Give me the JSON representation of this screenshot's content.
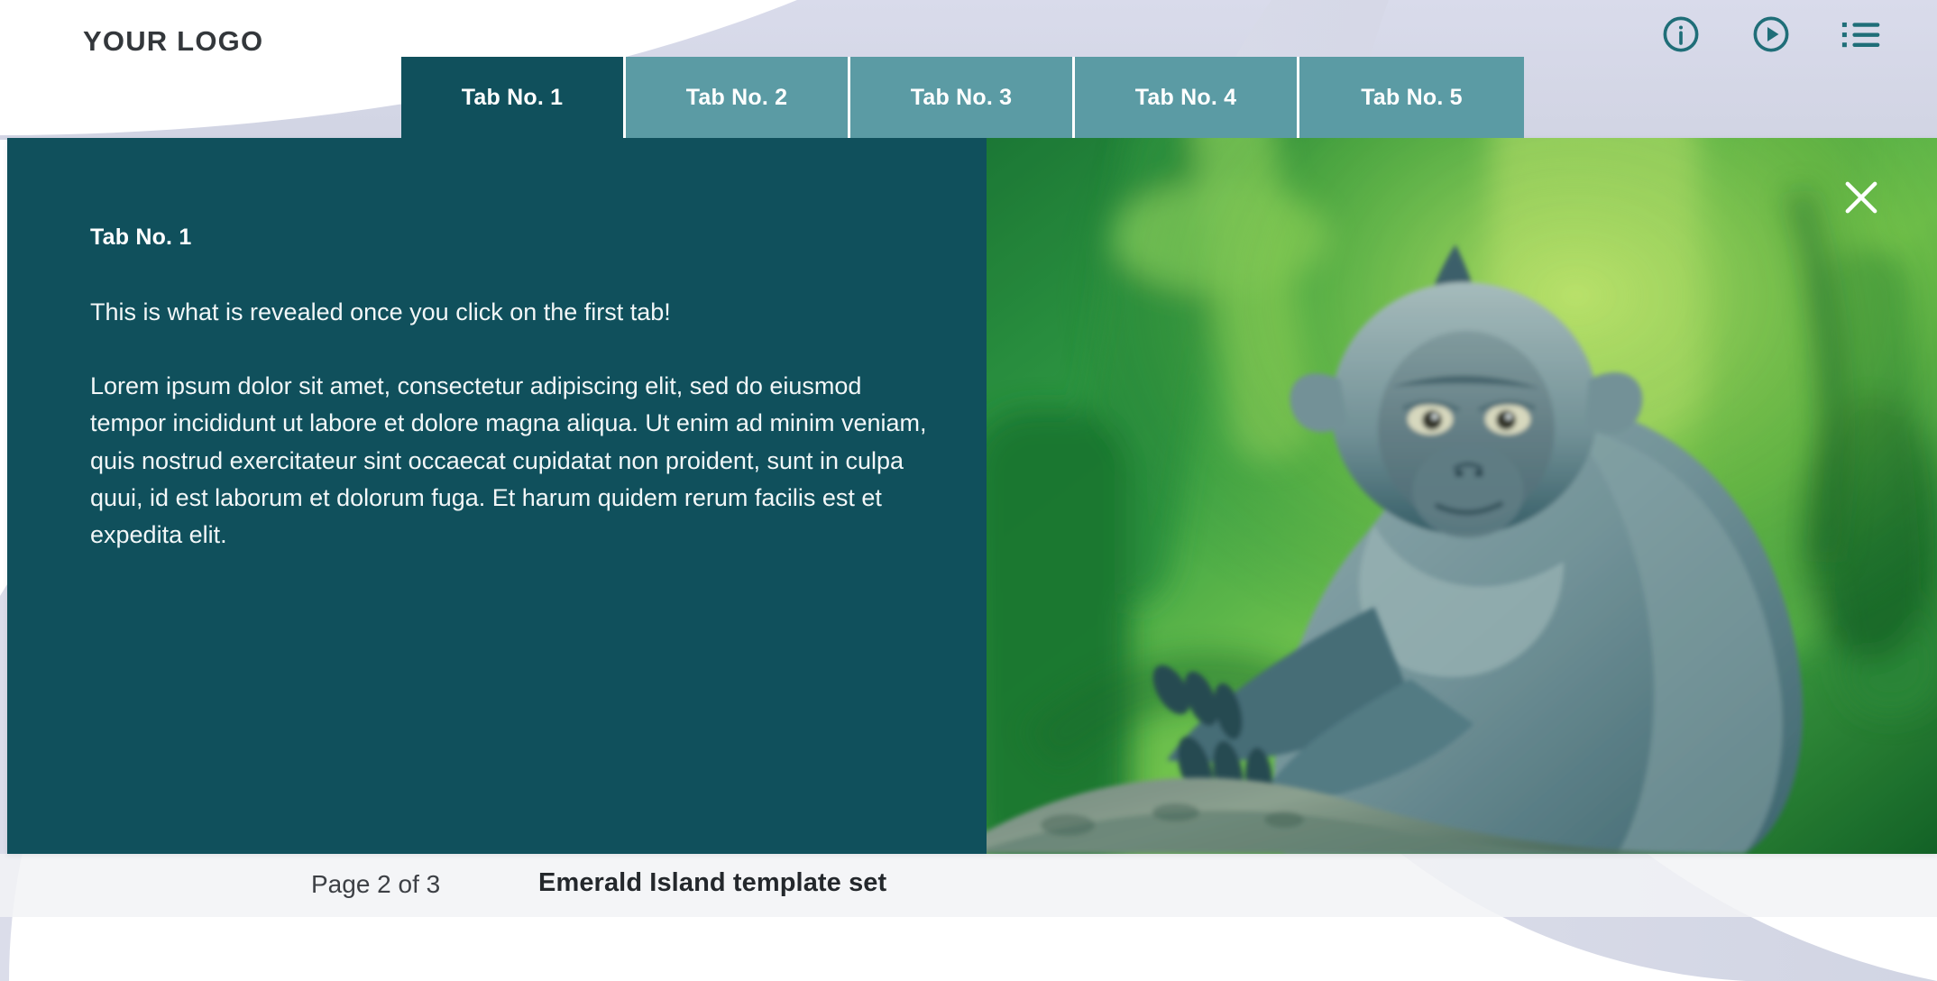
{
  "header": {
    "logo": "YOUR LOGO",
    "icons": [
      {
        "name": "info-icon",
        "label": "Information"
      },
      {
        "name": "play-icon",
        "label": "Play"
      },
      {
        "name": "list-menu-icon",
        "label": "Menu"
      }
    ]
  },
  "tabs": [
    {
      "label": "Tab No. 1",
      "active": true
    },
    {
      "label": "Tab No. 2",
      "active": false
    },
    {
      "label": "Tab No. 3",
      "active": false
    },
    {
      "label": "Tab No. 4",
      "active": false
    },
    {
      "label": "Tab No. 5",
      "active": false
    }
  ],
  "panel": {
    "title": "Tab No. 1",
    "lead": "This is what is revealed once you click on the first tab!",
    "body": "Lorem ipsum dolor sit amet, consectetur adipiscing elit, sed do eiusmod tempor incididunt ut labore et dolore magna aliqua. Ut enim ad minim veniam, quis nostrud exercitateur sint occaecat cupidatat non proident, sunt in culpa quui, id est laborum et dolorum fuga. Et harum quidem rerum facilis est et expedita elit.",
    "close_label": "Close",
    "image_alt": "Long-tailed macaque monkey sitting on a tree branch in a green bamboo forest"
  },
  "footer": {
    "page": "Page 2 of 3",
    "deck_title": "Emerald Island template set"
  },
  "colors": {
    "dark_teal": "#10505c",
    "light_teal": "#5b9ba4",
    "icon_teal": "#1f6e78",
    "decor_lavender": "#d5d7e3",
    "text_dark": "#33373b",
    "white": "#ffffff"
  }
}
